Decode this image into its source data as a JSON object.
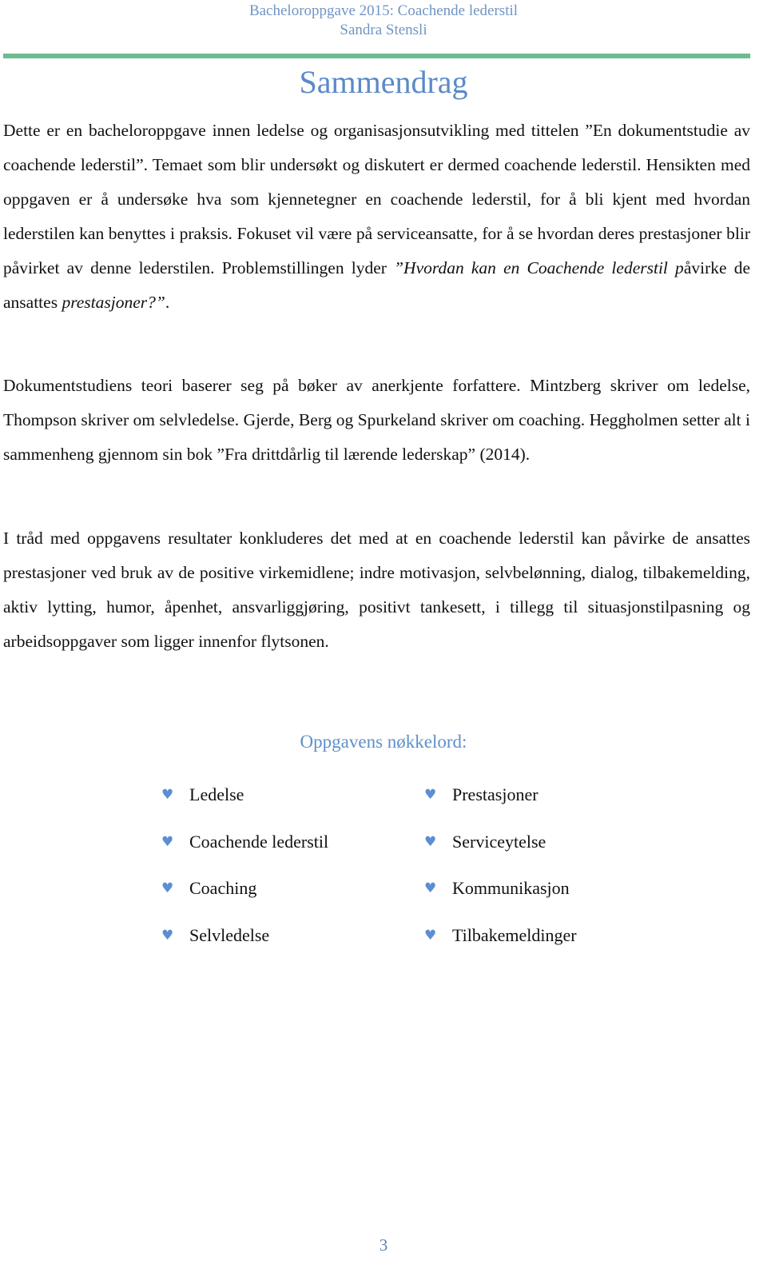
{
  "header": {
    "line1": "Bacheloroppgave 2015: Coachende lederstil",
    "line2": "Sandra Stensli"
  },
  "colors": {
    "header_text": "#6f95c4",
    "rule": "#6dbb91",
    "title": "#5a8ac8",
    "bullet": "#5b8ed2",
    "body_text": "#111111"
  },
  "title": "Sammendrag",
  "paragraphs": {
    "p1": {
      "intro": "Dette er en bacheloroppgave innen ledelse og organisasjonsutvikling med tittelen ”En dokumentstudie av coachende lederstil”.  Temaet som blir undersøkt og diskutert er dermed coachende lederstil. Hensikten med oppgaven er å undersøke hva som kjennetegner en coachende lederstil, for å bli kjent med hvordan lederstilen kan benyttes i praksis. Fokuset vil være på serviceansatte, for å se hvordan deres prestasjoner blir påvirket av denne lederstilen.",
      "problem_lead": "Problemstillingen lyder ",
      "problem_italic": "”Hvordan kan en Coachende lederstil p",
      "problem_mid": "åvirke de ansattes ",
      "problem_italic_end": "prestasjoner?”",
      "problem_end": "."
    },
    "p2": "Dokumentstudiens teori baserer seg på bøker av anerkjente forfattere. Mintzberg skriver om ledelse, Thompson skriver om selvledelse. Gjerde, Berg og Spurkeland skriver om coaching. Heggholmen setter alt i sammenheng gjennom sin bok ”Fra drittdårlig til lærende lederskap” (2014).",
    "p3": "I tråd med oppgavens resultater konkluderes det med at en coachende lederstil kan påvirke de ansattes prestasjoner ved bruk av de positive virkemidlene; indre motivasjon, selvbelønning, dialog, tilbakemelding, aktiv lytting, humor, åpenhet, ansvarliggjøring, positivt tankesett, i tillegg til situasjonstilpasning og arbeidsoppgaver som ligger innenfor flytsonen."
  },
  "keywords": {
    "title": "Oppgavens nøkkelord:",
    "bullet_icon": "heart-icon",
    "bullet_glyph": "♥",
    "left": [
      "Ledelse",
      "Coachende lederstil",
      "Coaching",
      "Selvledelse"
    ],
    "right": [
      "Prestasjoner",
      "Serviceytelse",
      "Kommunikasjon",
      "Tilbakemeldinger"
    ]
  },
  "page_number": "3"
}
